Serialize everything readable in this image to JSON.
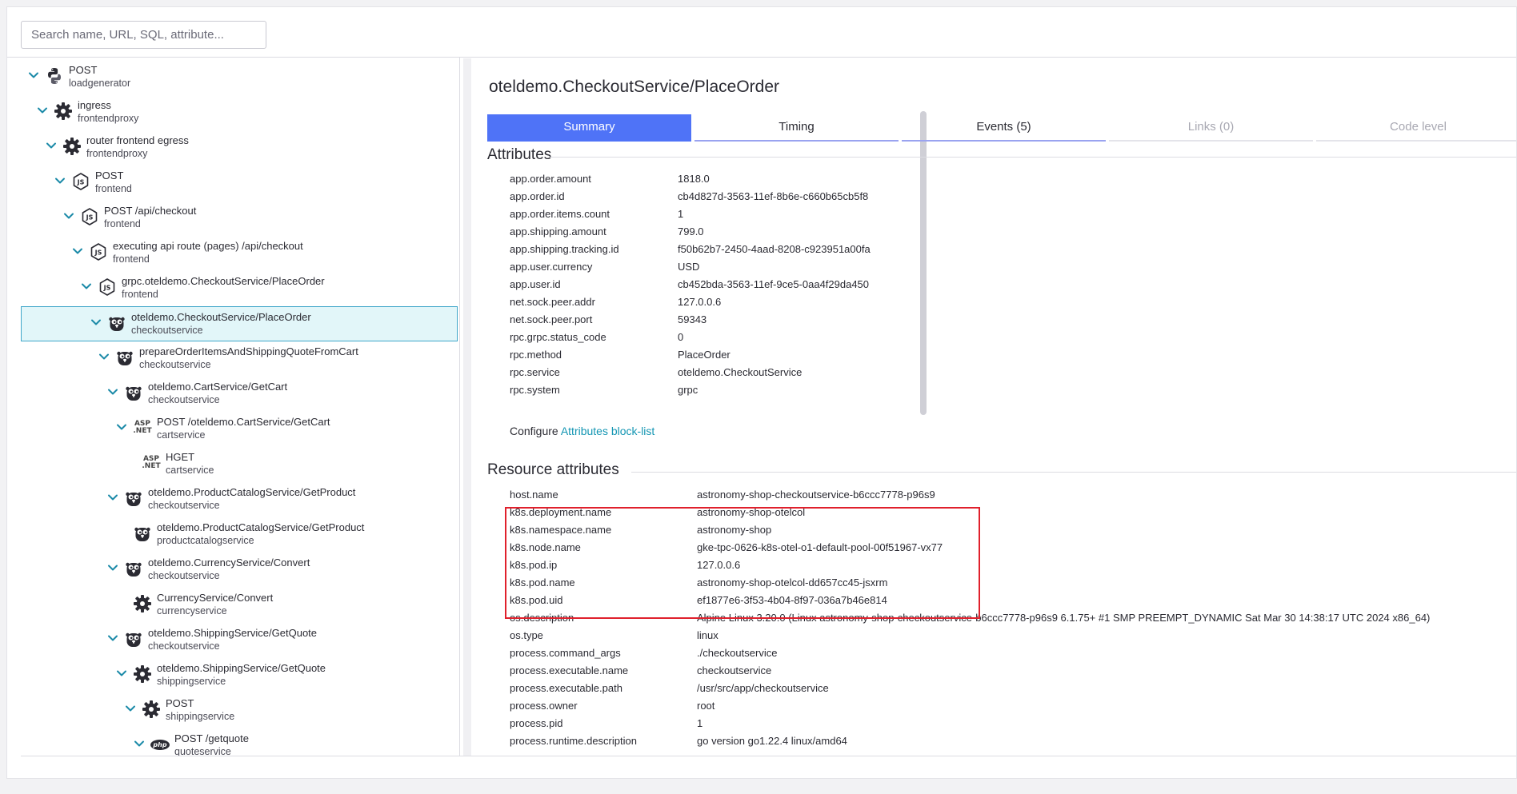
{
  "search": {
    "placeholder": "Search name, URL, SQL, attribute..."
  },
  "tree": [
    {
      "title": "POST",
      "service": "loadgenerator",
      "icon": "python-icon",
      "depth": 0
    },
    {
      "title": "ingress",
      "service": "frontendproxy",
      "icon": "gear-icon",
      "depth": 1
    },
    {
      "title": "router frontend egress",
      "service": "frontendproxy",
      "icon": "gear-icon",
      "depth": 2
    },
    {
      "title": "POST",
      "service": "frontend",
      "icon": "nodejs-icon",
      "depth": 3
    },
    {
      "title": "POST /api/checkout",
      "service": "frontend",
      "icon": "nodejs-icon",
      "depth": 4
    },
    {
      "title": "executing api route (pages) /api/checkout",
      "service": "frontend",
      "icon": "nodejs-icon",
      "depth": 5
    },
    {
      "title": "grpc.oteldemo.CheckoutService/PlaceOrder",
      "service": "frontend",
      "icon": "nodejs-icon",
      "depth": 6
    },
    {
      "title": "oteldemo.CheckoutService/PlaceOrder",
      "service": "checkoutservice",
      "icon": "go-gopher-icon",
      "depth": 7,
      "selected": true
    },
    {
      "title": "prepareOrderItemsAndShippingQuoteFromCart",
      "service": "checkoutservice",
      "icon": "go-gopher-icon",
      "depth": 8
    },
    {
      "title": "oteldemo.CartService/GetCart",
      "service": "checkoutservice",
      "icon": "go-gopher-icon",
      "depth": 9
    },
    {
      "title": "POST /oteldemo.CartService/GetCart",
      "service": "cartservice",
      "icon": "aspnet-icon",
      "depth": 10
    },
    {
      "title": "HGET",
      "service": "cartservice",
      "icon": "aspnet-icon",
      "depth": 11,
      "leaf": true
    },
    {
      "title": "oteldemo.ProductCatalogService/GetProduct",
      "service": "checkoutservice",
      "icon": "go-gopher-icon",
      "depth": 9
    },
    {
      "title": "oteldemo.ProductCatalogService/GetProduct",
      "service": "productcatalogservice",
      "icon": "go-gopher-icon",
      "depth": 10,
      "leaf": true
    },
    {
      "title": "oteldemo.CurrencyService/Convert",
      "service": "checkoutservice",
      "icon": "go-gopher-icon",
      "depth": 9
    },
    {
      "title": "CurrencyService/Convert",
      "service": "currencyservice",
      "icon": "gear-icon",
      "depth": 10,
      "leaf": true
    },
    {
      "title": "oteldemo.ShippingService/GetQuote",
      "service": "checkoutservice",
      "icon": "go-gopher-icon",
      "depth": 9
    },
    {
      "title": "oteldemo.ShippingService/GetQuote",
      "service": "shippingservice",
      "icon": "gear-icon",
      "depth": 10
    },
    {
      "title": "POST",
      "service": "shippingservice",
      "icon": "gear-icon",
      "depth": 11
    },
    {
      "title": "POST /getquote",
      "service": "quoteservice",
      "icon": "php-icon",
      "depth": 12
    }
  ],
  "detail": {
    "title": "oteldemo.CheckoutService/PlaceOrder",
    "tabs": [
      {
        "label": "Summary",
        "state": "active"
      },
      {
        "label": "Timing",
        "state": "normal"
      },
      {
        "label": "Events (5)",
        "state": "normal"
      },
      {
        "label": "Links (0)",
        "state": "disabled"
      },
      {
        "label": "Code level",
        "state": "disabled"
      }
    ],
    "attributes_title": "Attributes",
    "attributes": [
      {
        "key": "app.order.amount",
        "value": "1818.0"
      },
      {
        "key": "app.order.id",
        "value": "cb4d827d-3563-11ef-8b6e-c660b65cb5f8"
      },
      {
        "key": "app.order.items.count",
        "value": "1"
      },
      {
        "key": "app.shipping.amount",
        "value": "799.0"
      },
      {
        "key": "app.shipping.tracking.id",
        "value": "f50b62b7-2450-4aad-8208-c923951a00fa"
      },
      {
        "key": "app.user.currency",
        "value": "USD"
      },
      {
        "key": "app.user.id",
        "value": "cb452bda-3563-11ef-9ce5-0aa4f29da450"
      },
      {
        "key": "net.sock.peer.addr",
        "value": "127.0.0.6"
      },
      {
        "key": "net.sock.peer.port",
        "value": "59343"
      },
      {
        "key": "rpc.grpc.status_code",
        "value": "0"
      },
      {
        "key": "rpc.method",
        "value": "PlaceOrder"
      },
      {
        "key": "rpc.service",
        "value": "oteldemo.CheckoutService"
      },
      {
        "key": "rpc.system",
        "value": "grpc"
      }
    ],
    "configure_label": "Configure",
    "configure_link": "Attributes block-list",
    "resource_title": "Resource attributes",
    "resource_attributes": [
      {
        "key": "host.name",
        "value": "astronomy-shop-checkoutservice-b6ccc7778-p96s9"
      },
      {
        "key": "k8s.deployment.name",
        "value": "astronomy-shop-otelcol"
      },
      {
        "key": "k8s.namespace.name",
        "value": "astronomy-shop"
      },
      {
        "key": "k8s.node.name",
        "value": "gke-tpc-0626-k8s-otel-o1-default-pool-00f51967-vx77"
      },
      {
        "key": "k8s.pod.ip",
        "value": "127.0.0.6"
      },
      {
        "key": "k8s.pod.name",
        "value": "astronomy-shop-otelcol-dd657cc45-jsxrm"
      },
      {
        "key": "k8s.pod.uid",
        "value": "ef1877e6-3f53-4b04-8f97-036a7b46e814"
      },
      {
        "key": "os.description",
        "value": "Alpine Linux 3.20.0 (Linux astronomy-shop-checkoutservice-b6ccc7778-p96s9 6.1.75+ #1 SMP PREEMPT_DYNAMIC Sat Mar 30 14:38:17 UTC 2024 x86_64)"
      },
      {
        "key": "os.type",
        "value": "linux"
      },
      {
        "key": "process.command_args",
        "value": "./checkoutservice"
      },
      {
        "key": "process.executable.name",
        "value": "checkoutservice"
      },
      {
        "key": "process.executable.path",
        "value": "/usr/src/app/checkoutservice"
      },
      {
        "key": "process.owner",
        "value": "root"
      },
      {
        "key": "process.pid",
        "value": "1"
      },
      {
        "key": "process.runtime.description",
        "value": "go version go1.22.4 linux/amd64"
      }
    ],
    "highlight_color": "#e0202c",
    "accent_color": "#4f73f7",
    "link_color": "#1496b3"
  }
}
